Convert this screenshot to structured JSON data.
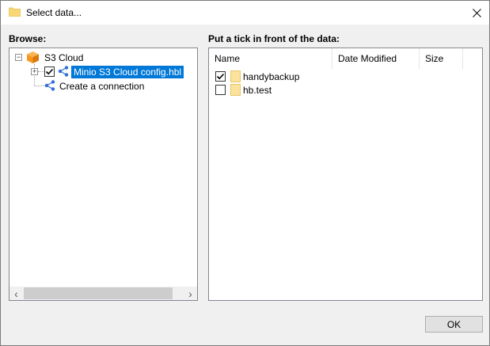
{
  "window": {
    "title": "Select data...",
    "close_glyph": "✕"
  },
  "browse": {
    "label": "Browse:",
    "tree": {
      "root": {
        "label": "S3 Cloud",
        "icon": "s3-cube-icon",
        "expander": "−"
      },
      "children": [
        {
          "label": "Minio S3 Cloud config.hbl",
          "icon": "share-node-icon",
          "expander": "+",
          "checked": true,
          "selected": true
        },
        {
          "label": "Create a connection",
          "icon": "share-node-icon"
        }
      ]
    },
    "scroll": {
      "left": "‹",
      "right": "›"
    }
  },
  "data_list": {
    "label": "Put a tick in front of the data:",
    "columns": [
      "Name",
      "Date Modified",
      "Size"
    ],
    "rows": [
      {
        "name": "handybackup",
        "checked": true
      },
      {
        "name": "hb.test",
        "checked": false
      }
    ]
  },
  "buttons": {
    "ok": "OK"
  },
  "colors": {
    "selection": "#0078d7",
    "folder": "#fbe39b",
    "s3_orange": "#f7981d"
  }
}
